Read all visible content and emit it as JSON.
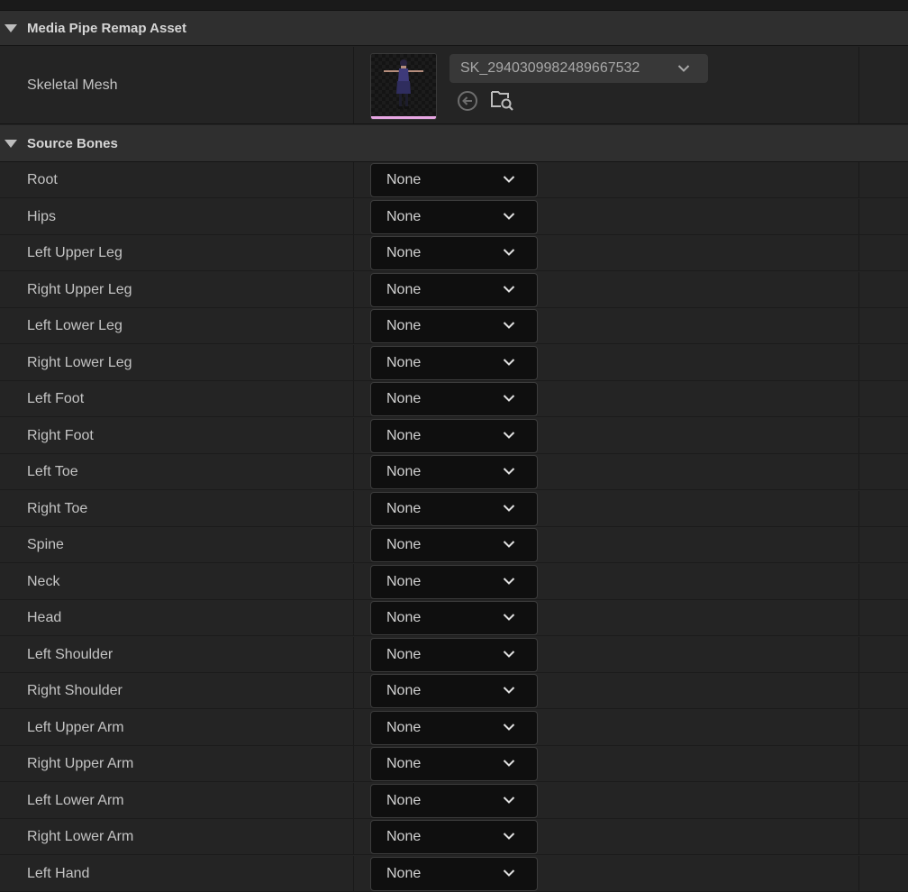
{
  "remap_section": {
    "title": "Media Pipe Remap Asset",
    "skeletal_mesh": {
      "label": "Skeletal Mesh",
      "value": "SK_2940309982489667532",
      "thumbnail_accent": "#e7a6e3"
    }
  },
  "bones_section": {
    "title": "Source Bones",
    "rows": [
      {
        "label": "Root",
        "value": "None"
      },
      {
        "label": "Hips",
        "value": "None"
      },
      {
        "label": "Left Upper Leg",
        "value": "None"
      },
      {
        "label": "Right Upper Leg",
        "value": "None"
      },
      {
        "label": "Left Lower Leg",
        "value": "None"
      },
      {
        "label": "Right Lower Leg",
        "value": "None"
      },
      {
        "label": "Left Foot",
        "value": "None"
      },
      {
        "label": "Right Foot",
        "value": "None"
      },
      {
        "label": "Left Toe",
        "value": "None"
      },
      {
        "label": "Right Toe",
        "value": "None"
      },
      {
        "label": "Spine",
        "value": "None"
      },
      {
        "label": "Neck",
        "value": "None"
      },
      {
        "label": "Head",
        "value": "None"
      },
      {
        "label": "Left Shoulder",
        "value": "None"
      },
      {
        "label": "Right Shoulder",
        "value": "None"
      },
      {
        "label": "Left Upper Arm",
        "value": "None"
      },
      {
        "label": "Right Upper Arm",
        "value": "None"
      },
      {
        "label": "Left Lower Arm",
        "value": "None"
      },
      {
        "label": "Right Lower Arm",
        "value": "None"
      },
      {
        "label": "Left Hand",
        "value": "None"
      }
    ]
  }
}
